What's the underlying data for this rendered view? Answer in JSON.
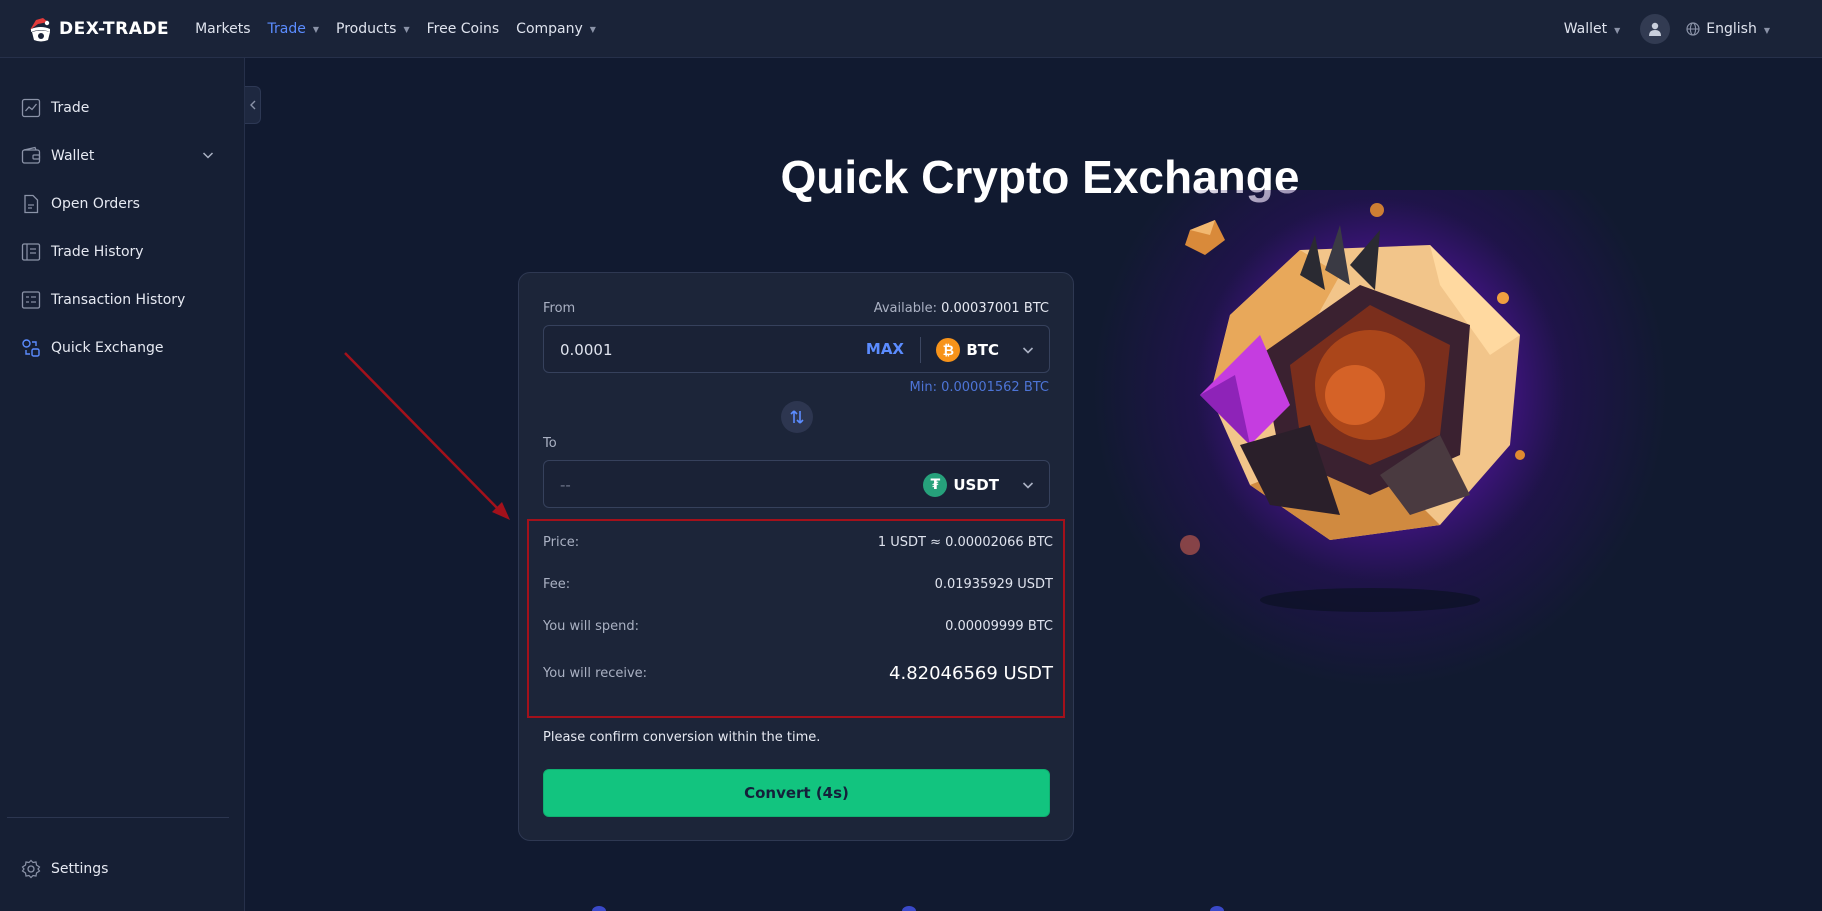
{
  "header": {
    "logo_text": "DEX-TRADE",
    "nav": [
      {
        "label": "Markets",
        "has_caret": false,
        "active": false
      },
      {
        "label": "Trade",
        "has_caret": true,
        "active": true
      },
      {
        "label": "Products",
        "has_caret": true,
        "active": false
      },
      {
        "label": "Free Coins",
        "has_caret": false,
        "active": false
      },
      {
        "label": "Company",
        "has_caret": true,
        "active": false
      }
    ],
    "wallet_label": "Wallet",
    "language_label": "English"
  },
  "sidebar": {
    "items": [
      {
        "label": "Trade",
        "icon": "chart-line-icon"
      },
      {
        "label": "Wallet",
        "icon": "wallet-icon"
      },
      {
        "label": "Open Orders",
        "icon": "document-icon"
      },
      {
        "label": "Trade History",
        "icon": "book-icon"
      },
      {
        "label": "Transaction History",
        "icon": "receipt-icon"
      },
      {
        "label": "Quick Exchange",
        "icon": "exchange-icon"
      }
    ],
    "settings_label": "Settings"
  },
  "page_title": "Quick Crypto Exchange",
  "exchange": {
    "from_label": "From",
    "available_label": "Available:",
    "available_value": "0.00037001 BTC",
    "from_amount": "0.0001",
    "max_label": "MAX",
    "from_coin": "BTC",
    "min_text": "Min: 0.00001562 BTC",
    "to_label": "To",
    "to_amount": "--",
    "to_coin": "USDT",
    "details": {
      "price_label": "Price:",
      "price_value": "1 USDT ≈ 0.00002066 BTC",
      "fee_label": "Fee:",
      "fee_value": "0.01935929 USDT",
      "spend_label": "You will spend:",
      "spend_value": "0.00009999 BTC",
      "receive_label": "You will receive:",
      "receive_value": "4.82046569 USDT"
    },
    "confirm_text": "Please confirm conversion within the time.",
    "convert_label": "Convert (4s)"
  },
  "colors": {
    "accent": "#5b8cff",
    "convert_button": "#12c47f",
    "highlight_box": "#a3111b",
    "btc": "#f7931a",
    "usdt": "#26a17b"
  }
}
